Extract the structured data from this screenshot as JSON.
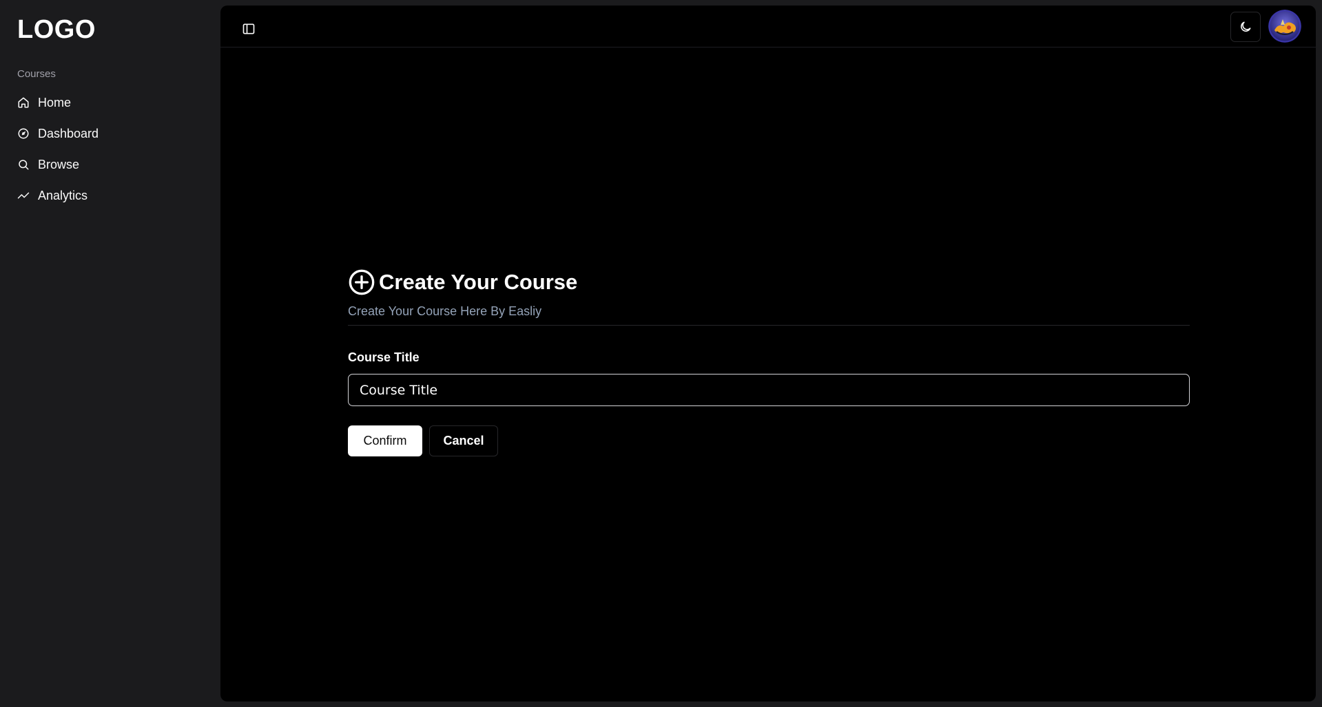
{
  "sidebar": {
    "logo": "LOGO",
    "section_label": "Courses",
    "items": [
      {
        "label": "Home",
        "icon": "home-icon"
      },
      {
        "label": "Dashboard",
        "icon": "gauge-icon"
      },
      {
        "label": "Browse",
        "icon": "search-icon"
      },
      {
        "label": "Analytics",
        "icon": "trend-line-icon"
      }
    ]
  },
  "topbar": {
    "toggle_icon": "sidebar-toggle-icon",
    "theme_icon": "moon-icon",
    "avatar": "user-avatar"
  },
  "form": {
    "title_icon": "plus-circle-icon",
    "title": "Create Your Course",
    "subtitle": "Create Your Course Here By Easliy",
    "field_label": "Course Title",
    "field_value": "Course Title",
    "confirm_label": "Confirm",
    "cancel_label": "Cancel"
  },
  "colors": {
    "sidebar_bg": "#1b1b1d",
    "main_bg": "#000000",
    "text": "#fafafa",
    "muted": "#94a3b8",
    "border": "#27272a"
  }
}
